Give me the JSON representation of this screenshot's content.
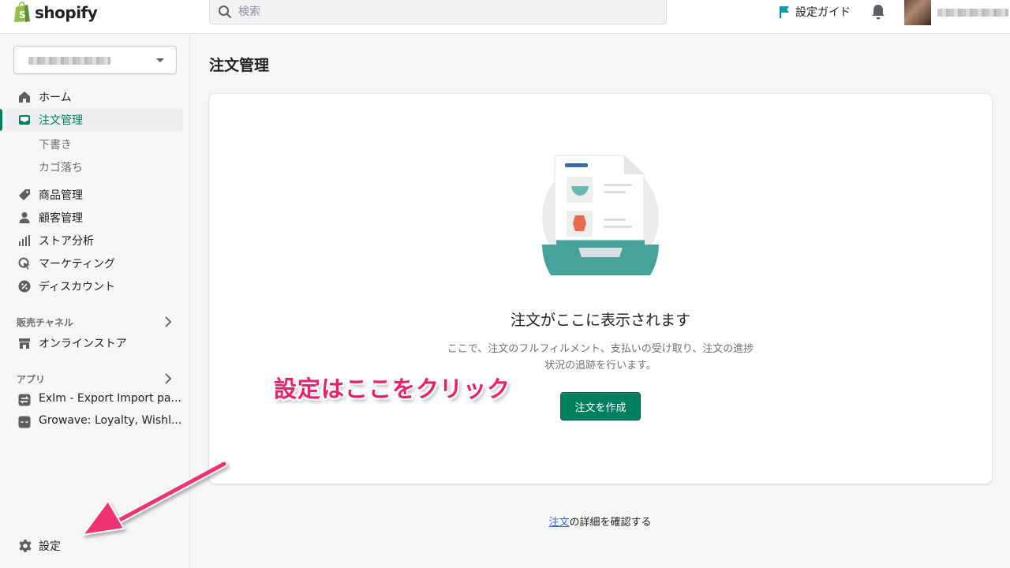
{
  "brand": {
    "name": "shopify"
  },
  "topbar": {
    "search_placeholder": "検索",
    "setup_guide": "設定ガイド"
  },
  "sidebar": {
    "items": [
      {
        "label": "ホーム"
      },
      {
        "label": "注文管理"
      },
      {
        "label": "下書き"
      },
      {
        "label": "カゴ落ち"
      },
      {
        "label": "商品管理"
      },
      {
        "label": "顧客管理"
      },
      {
        "label": "ストア分析"
      },
      {
        "label": "マーケティング"
      },
      {
        "label": "ディスカウント"
      }
    ],
    "sales_channels_title": "販売チャネル",
    "sales_channels": [
      {
        "label": "オンラインストア"
      }
    ],
    "apps_title": "アプリ",
    "apps": [
      {
        "label": "ExIm - Export Import pa..."
      },
      {
        "label": "Growave: Loyalty, Wishl..."
      }
    ],
    "settings_label": "設定"
  },
  "main": {
    "page_title": "注文管理",
    "empty_state": {
      "heading": "注文がここに表示されます",
      "description": "ここで、注文のフルフィルメント、支払いの受け取り、注文の進捗状況の追跡を行います。",
      "button": "注文を作成"
    },
    "footer": {
      "link": "注文",
      "text": "の詳細を確認する"
    }
  },
  "annotation": {
    "text": "設定はここをクリック",
    "color": "#e9216b"
  },
  "colors": {
    "accent": "#008060",
    "link": "#2c6ecb"
  }
}
